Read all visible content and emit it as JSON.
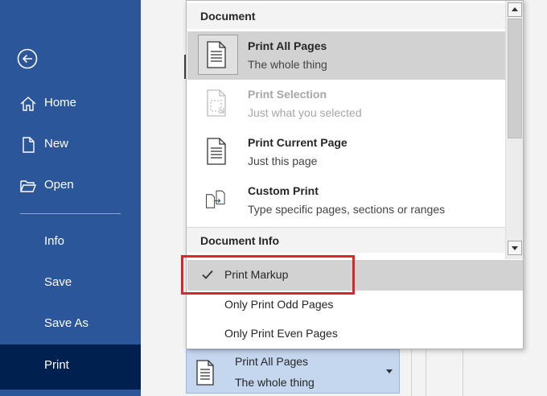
{
  "sidebar": {
    "items": [
      {
        "label": "Home"
      },
      {
        "label": "New"
      },
      {
        "label": "Open"
      },
      {
        "label": "Info"
      },
      {
        "label": "Save"
      },
      {
        "label": "Save As"
      },
      {
        "label": "Print"
      }
    ],
    "active": "Print"
  },
  "dropdown": {
    "section_document": "Document",
    "options": [
      {
        "title": "Print All Pages",
        "subtitle": "The whole thing",
        "selected": true
      },
      {
        "title": "Print Selection",
        "subtitle": "Just what you selected",
        "disabled": true
      },
      {
        "title": "Print Current Page",
        "subtitle": "Just this page"
      },
      {
        "title": "Custom Print",
        "subtitle": "Type specific pages, sections or ranges"
      }
    ],
    "section_docinfo": "Document Info",
    "menu_items": [
      {
        "label": "Print Markup",
        "checked": true
      },
      {
        "label": "Only Print Odd Pages"
      },
      {
        "label": "Only Print Even Pages"
      }
    ]
  },
  "print_what": {
    "title": "Print All Pages",
    "subtitle": "The whole thing"
  },
  "colors": {
    "sidebar_bg": "#2b579a",
    "sidebar_active": "#002050",
    "highlight_border": "#d9262b",
    "selected_bg": "#d2d2d2"
  }
}
